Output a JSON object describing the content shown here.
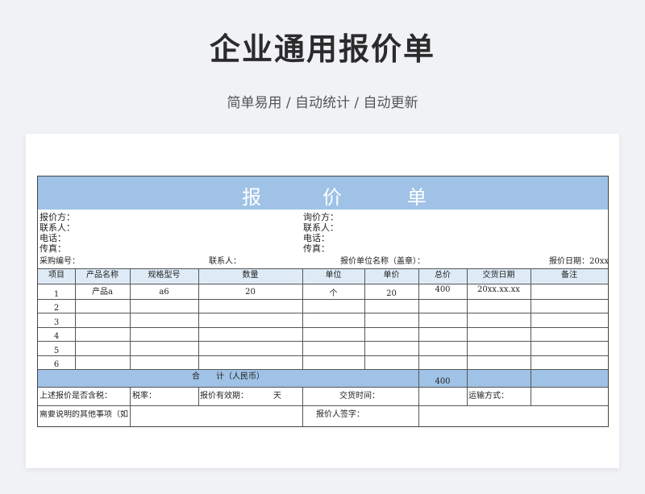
{
  "header": {
    "title": "企业通用报价单",
    "subtitle": "简单易用 / 自动统计 / 自动更新"
  },
  "sheet": {
    "banner_chars": [
      "报",
      "价",
      "单"
    ],
    "left_info": [
      "报价方：",
      "联系人：",
      "电话：",
      "传真："
    ],
    "right_info": [
      "询价方：",
      "联系人：",
      "电话：",
      "传真："
    ],
    "meta_row": {
      "buyer_no": "采购编号：",
      "contact": "联系人：",
      "quote_unit": "报价单位名称（盖章）：",
      "quote_date": "报价日期：20xx"
    },
    "columns": [
      "项目",
      "产品名称",
      "规格型号",
      "数量",
      "单位",
      "单价",
      "总价",
      "交货日期",
      "备注"
    ],
    "rows": [
      [
        "1",
        "产品a",
        "a6",
        "20",
        "个",
        "20",
        "400",
        "20xx.xx.xx",
        ""
      ],
      [
        "2",
        "",
        "",
        "",
        "",
        "",
        "",
        "",
        ""
      ],
      [
        "3",
        "",
        "",
        "",
        "",
        "",
        "",
        "",
        ""
      ],
      [
        "4",
        "",
        "",
        "",
        "",
        "",
        "",
        "",
        ""
      ],
      [
        "5",
        "",
        "",
        "",
        "",
        "",
        "",
        "",
        ""
      ],
      [
        "6",
        "",
        "",
        "",
        "",
        "",
        "",
        "",
        ""
      ]
    ],
    "sum": {
      "label": "合　　计（人民币）",
      "total": "400"
    },
    "footer1": {
      "tax_included": "上述报价是否含税：",
      "tax_rate": "税率：",
      "validity": "报价有效期：",
      "days": "天",
      "delivery_time": "交货时间：",
      "transport": "运输方式："
    },
    "footer2": {
      "other": "需要说明的其他事项（如",
      "signature": "报价人签字："
    }
  }
}
